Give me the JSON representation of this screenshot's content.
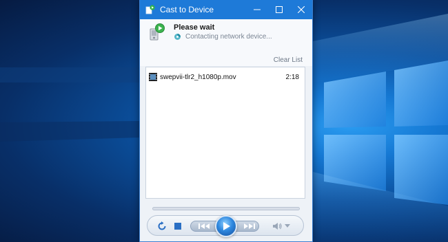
{
  "window": {
    "title": "Cast to Device",
    "minimize_icon": "minimize-icon",
    "maximize_icon": "maximize-icon",
    "close_icon": "close-icon"
  },
  "status": {
    "title": "Please wait",
    "message": "Contacting network device...",
    "clear_list": "Clear List"
  },
  "playlist": {
    "items": [
      {
        "name": "swepvii-tlr2_h1080p.mov",
        "duration": "2:18",
        "icon": "video-file-icon"
      }
    ]
  },
  "controls": {
    "buttons": [
      "repeat-icon",
      "stop-icon",
      "previous-icon",
      "play-icon",
      "next-icon",
      "volume-icon"
    ]
  },
  "colors": {
    "titlebar": "#1e7ad8",
    "desktop": "#0b4f9c",
    "play_button": "#2f88df"
  }
}
